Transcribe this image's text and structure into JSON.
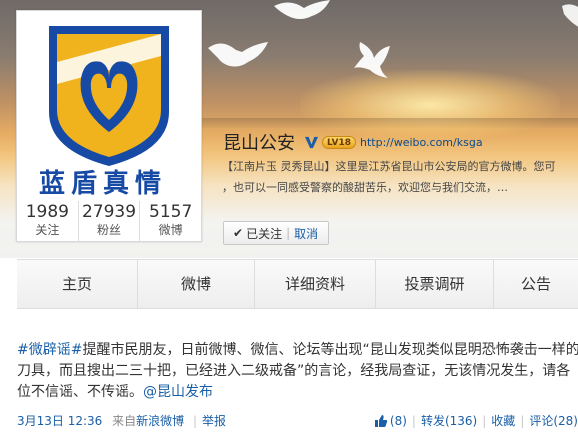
{
  "profile": {
    "name": "昆山公安",
    "level": "LV18",
    "url": "http://weibo.com/ksga",
    "bio_line1": "【江南片玉 灵秀昆山】这里是江苏省昆山市公安局的官方微博。您可",
    "bio_line2": "，也可以一同感受警察的酸甜苦乐，欢迎您与我们交流，…",
    "slogan": "蓝盾真情",
    "follow_label": "已关注",
    "cancel_label": "取消"
  },
  "stats": [
    {
      "num": "1989",
      "label": "关注"
    },
    {
      "num": "27939",
      "label": "粉丝"
    },
    {
      "num": "5157",
      "label": "微博"
    }
  ],
  "tabs": [
    "主页",
    "微博",
    "详细资料",
    "投票调研",
    "公告"
  ],
  "post": {
    "hashtag": "#微辟谣#",
    "line1_rest": "提醒市民朋友，日前微博、微信、论坛等出现“昆山发现类似昆明恐怖袭击一样的",
    "line2": "刀具，而且搜出二三十把，已经进入二级戒备”的言论，经我局查证，无该情况发生，请各",
    "line3_text": "位不信谣、不传谣。",
    "mention": "@昆山发布",
    "time": "3月13日 12:36",
    "source_prefix": "来自",
    "source": "新浪微博",
    "report": "举报",
    "likes": "(8)",
    "repost": "转发(136)",
    "favorite": "收藏",
    "comment": "评论(28)"
  },
  "colors": {
    "link": "#1a5fa8",
    "shield_blue": "#174aa5",
    "shield_gold": "#f0b21d"
  }
}
